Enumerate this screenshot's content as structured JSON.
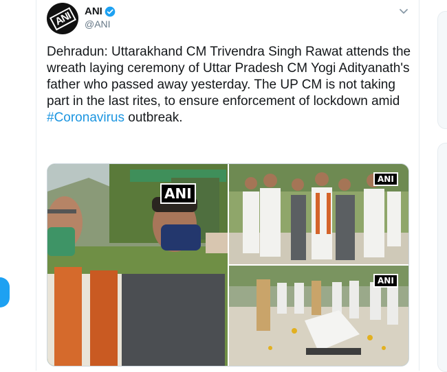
{
  "author": {
    "name": "ANI",
    "handle": "@ANI",
    "avatar_text": "ANI",
    "verified": true
  },
  "tweet": {
    "text_before_hashtag": "Dehradun: Uttarakhand CM Trivendra Singh Rawat attends the wreath laying ceremony of Uttar Pradesh CM Yogi Adityanath's father who passed away yesterday. The UP CM is not taking part in the last rites, to ensure enforcement of lockdown amid ",
    "hashtag": "#Coronavirus",
    "text_after_hashtag": " outbreak."
  },
  "media": {
    "watermark": "ANI",
    "photo_count": 3
  },
  "colors": {
    "link": "#1b95e0",
    "verified": "#1da1f2"
  },
  "icons": {
    "verified": "verified-badge-icon",
    "caret": "chevron-down-icon"
  }
}
